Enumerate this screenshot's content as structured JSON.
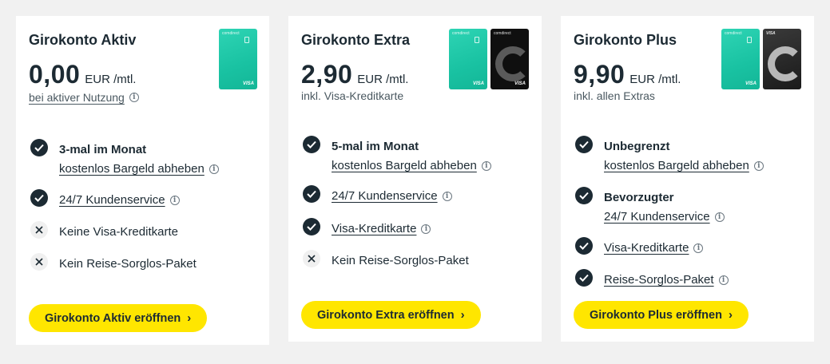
{
  "plans": [
    {
      "title": "Girokonto Aktiv",
      "price": "0,00",
      "unit": "EUR /mtl.",
      "note": "bei aktiver Nutzung",
      "features": [
        {
          "type": "check",
          "bold": "3-mal im Monat",
          "text": "kostenlos Bargeld abheben",
          "info": true
        },
        {
          "type": "check",
          "text": "24/7 Kundenservice",
          "info": true
        },
        {
          "type": "cross",
          "text": "Keine Visa-Kreditkarte"
        },
        {
          "type": "cross",
          "text": "Kein Reise-Sorglos-Paket"
        }
      ],
      "cta": "Girokonto Aktiv eröffnen"
    },
    {
      "title": "Girokonto Extra",
      "price": "2,90",
      "unit": "EUR /mtl.",
      "note": "inkl. Visa-Kreditkarte",
      "features": [
        {
          "type": "check",
          "bold": "5-mal im Monat",
          "text": "kostenlos Bargeld abheben",
          "info": true
        },
        {
          "type": "check",
          "text": "24/7 Kundenservice",
          "info": true
        },
        {
          "type": "check",
          "text": "Visa-Kreditkarte",
          "info": true
        },
        {
          "type": "cross",
          "text": "Kein Reise-Sorglos-Paket"
        }
      ],
      "cta": "Girokonto Extra eröffnen"
    },
    {
      "title": "Girokonto Plus",
      "price": "9,90",
      "unit": "EUR /mtl.",
      "note": "inkl. allen Extras",
      "features": [
        {
          "type": "check",
          "bold": "Unbegrenzt",
          "text": "kostenlos Bargeld abheben",
          "info": true
        },
        {
          "type": "check",
          "bold": "Bevorzugter",
          "text": "24/7 Kundenservice",
          "info": true
        },
        {
          "type": "check",
          "text": "Visa-Kreditkarte",
          "info": true
        },
        {
          "type": "check",
          "text": "Reise-Sorglos-Paket",
          "info": true
        }
      ],
      "cta": "Girokonto Plus eröffnen"
    }
  ],
  "card_art": {
    "brand": "comdirect",
    "network": "VISA"
  },
  "icons": {
    "info": "info-icon",
    "check": "check-icon",
    "cross": "cross-icon",
    "chevron": "chevron-right-icon"
  },
  "colors": {
    "cta": "#ffe600",
    "check_bg": "#1c2a33",
    "card_green": "#19c2a2",
    "page_bg": "#f1f1f1"
  }
}
